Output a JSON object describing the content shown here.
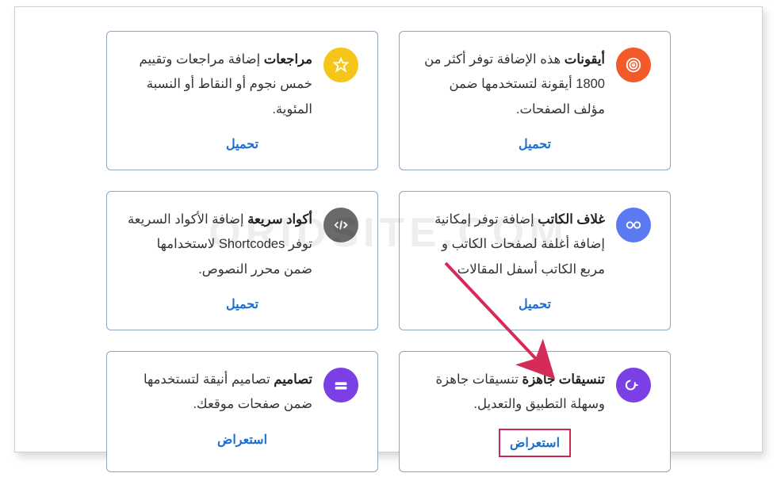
{
  "watermark": "ORIDSITE.COM",
  "actions": {
    "download": "تحميل",
    "browse": "استعراض"
  },
  "cards": [
    {
      "title": "أيقونات",
      "description": " هذه الإضافة توفر أكثر من 1800 أيقونة لتستخدمها ضمن مؤلف الصفحات.",
      "icon_color": "#f35a2a",
      "icon": "spiral",
      "action": "download"
    },
    {
      "title": "مراجعات",
      "description": " إضافة مراجعات وتقييم خمس نجوم أو النقاط أو النسبة المئوية.",
      "icon_color": "#f5c518",
      "icon": "star",
      "action": "download"
    },
    {
      "title": "غلاف الكاتب",
      "description": " إضافة توفر إمكانية إضافة أغلفة لصفحات الكاتب و مربع الكاتب أسفل المقالات.",
      "icon_color": "#5b7af2",
      "icon": "glasses",
      "action": "download"
    },
    {
      "title": "أكواد سريعة",
      "description": " إضافة الأكواد السريعة توفر Shortcodes لاستخدامها ضمن محرر النصوص.",
      "icon_color": "#6a6a6a",
      "icon": "code",
      "action": "download"
    },
    {
      "title": "تنسيقات جاهزة",
      "description": " تنسيقات جاهزة وسهلة التطبيق والتعديل.",
      "icon_color": "#7a3fe5",
      "icon": "loop",
      "action": "browse",
      "highlighted": true
    },
    {
      "title": "تصاميم",
      "description": " تصاميم أنيقة لتستخدمها ضمن صفحات موقعك.",
      "icon_color": "#7a3fe5",
      "icon": "layers",
      "action": "browse"
    }
  ]
}
